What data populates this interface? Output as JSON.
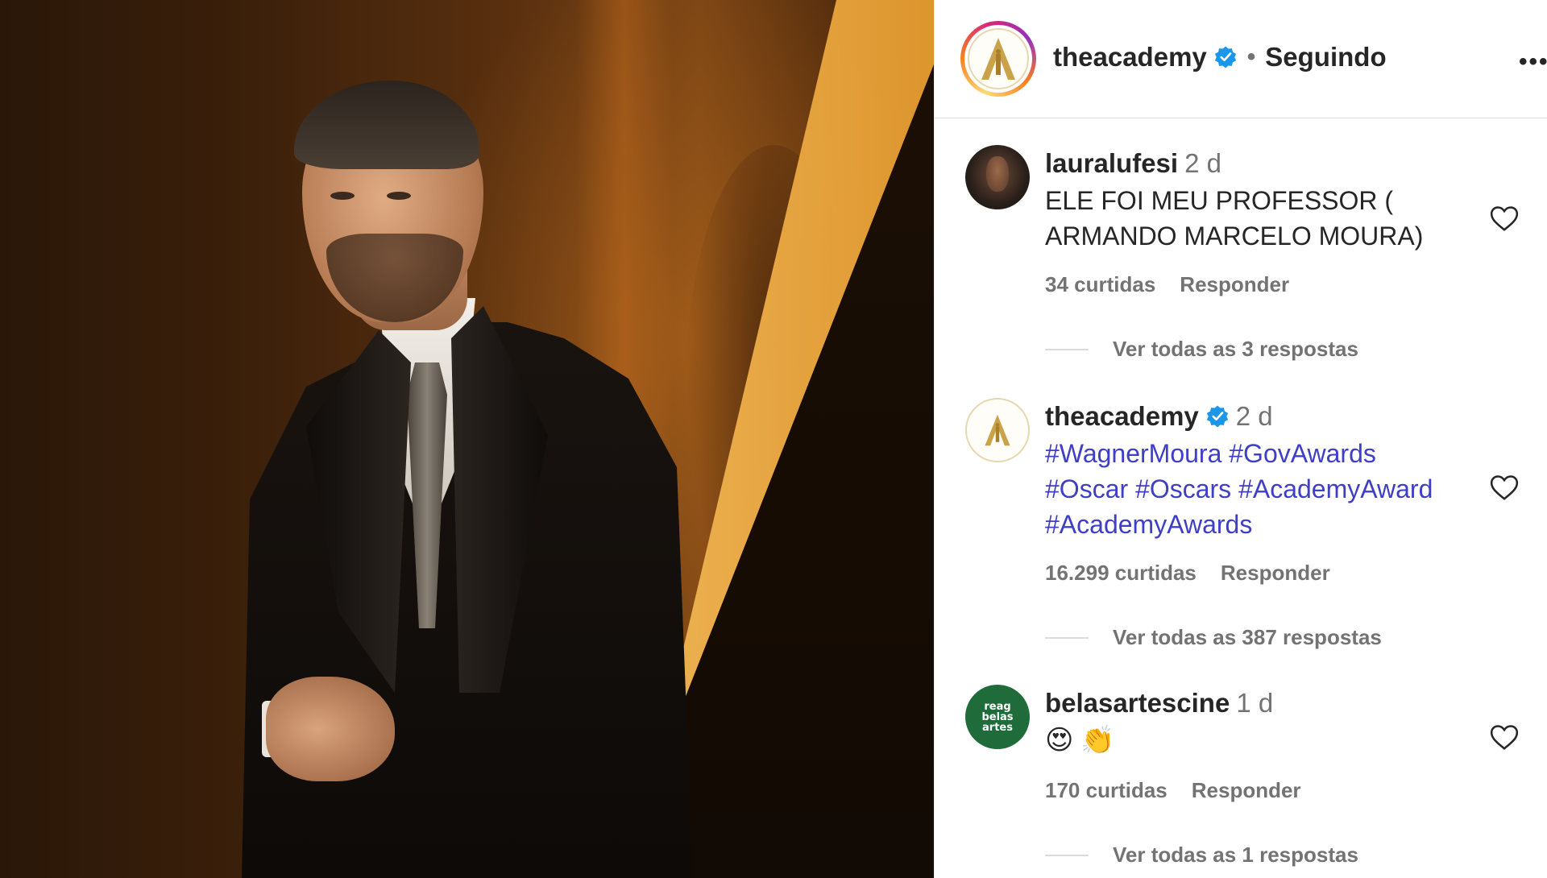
{
  "post": {
    "author": "theacademy",
    "separator": "•",
    "follow_status": "Seguindo",
    "more_label": "•••"
  },
  "comments": [
    {
      "user": "lauralufesi",
      "time": "2 d",
      "text": "ELE FOI MEU PROFESSOR ( ARMANDO MARCELO MOURA)",
      "likes": "34 curtidas",
      "reply": "Responder",
      "view_replies": "Ver todas as 3 respostas"
    },
    {
      "user": "theacademy",
      "verified": true,
      "time": "2 d",
      "hashtags": [
        "#WagnerMoura",
        "#GovAwards",
        "#Oscar",
        "#Oscars",
        "#AcademyAward",
        "#AcademyAwards"
      ],
      "likes": "16.299 curtidas",
      "reply": "Responder",
      "view_replies": "Ver todas as 387 respostas"
    },
    {
      "user": "belasartescine",
      "time": "1 d",
      "emojis": [
        "😍",
        "👏"
      ],
      "likes": "170 curtidas",
      "reply": "Responder",
      "view_replies": "Ver todas as 1 respostas",
      "avatar_text": "reag belas artes"
    }
  ],
  "colors": {
    "hashtag": "#3f3fc6",
    "verified": "#1c96e8",
    "muted": "#737373",
    "text": "#262626",
    "academy_gold": "#c9a24a"
  },
  "icons": {
    "verified": "verified-badge-icon",
    "heart": "heart-outline-icon",
    "more": "more-options-icon",
    "logo": "academy-oscar-logo"
  }
}
